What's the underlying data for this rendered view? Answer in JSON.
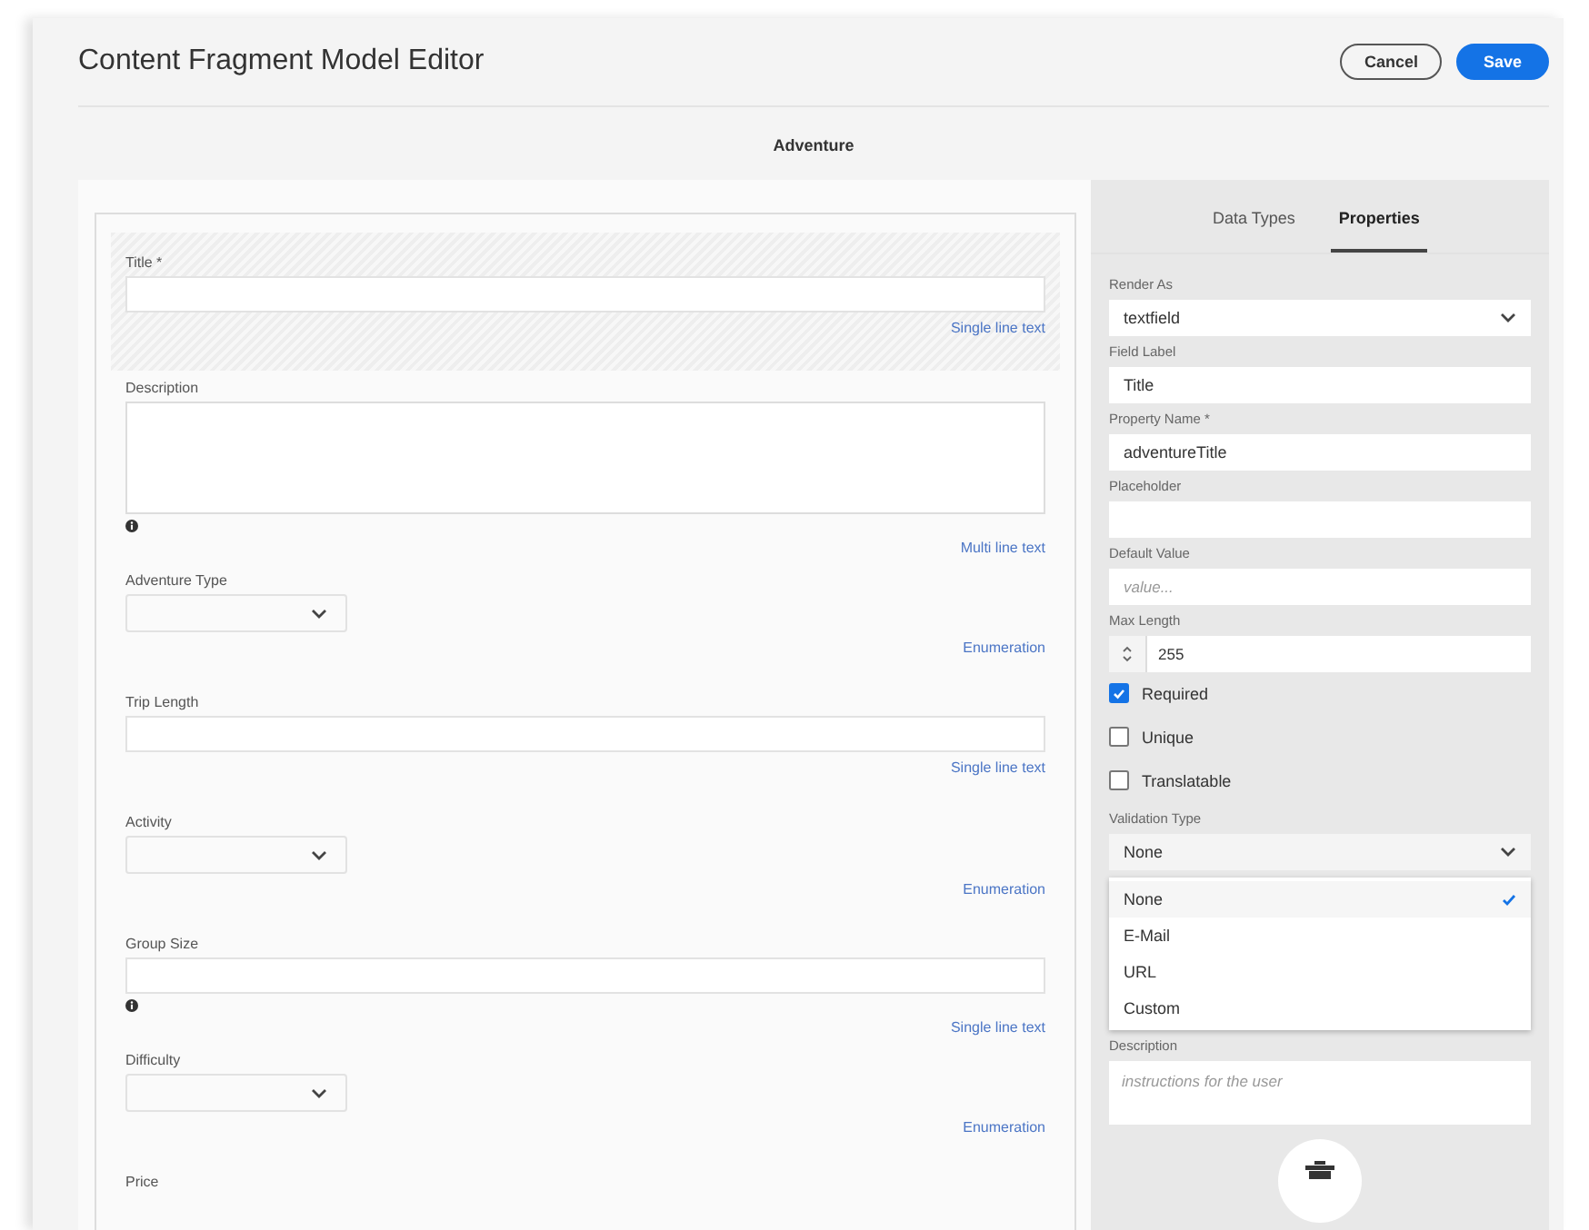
{
  "header": {
    "title": "Content Fragment Model Editor",
    "buttons": [
      {
        "label": "Cancel",
        "kind": "secondary"
      },
      {
        "label": "Save",
        "kind": "primary"
      }
    ]
  },
  "model_name": "Adventure",
  "fields": [
    {
      "label": "Title *",
      "kind": "text",
      "info": false,
      "type": "Single line text",
      "selected": true
    },
    {
      "label": "Description",
      "kind": "textarea",
      "info": true,
      "type": "Multi line text",
      "selected": false
    },
    {
      "label": "Adventure Type",
      "kind": "select",
      "info": false,
      "type": "Enumeration",
      "selected": false
    },
    {
      "label": "Trip Length",
      "kind": "text",
      "info": false,
      "type": "Single line text",
      "selected": false
    },
    {
      "label": "Activity",
      "kind": "select",
      "info": false,
      "type": "Enumeration",
      "selected": false
    },
    {
      "label": "Group Size",
      "kind": "text",
      "info": true,
      "type": "Single line text",
      "selected": false
    },
    {
      "label": "Difficulty",
      "kind": "select",
      "info": false,
      "type": "Enumeration",
      "selected": false
    },
    {
      "label": "Price",
      "kind": "label"
    }
  ],
  "tabs": [
    {
      "label": "Data Types",
      "selected": false
    },
    {
      "label": "Properties",
      "selected": true
    }
  ],
  "properties": [
    {
      "kind": "select",
      "label": "Render As",
      "value": "textfield"
    },
    {
      "kind": "input",
      "label": "Field Label",
      "value": "Title"
    },
    {
      "kind": "input",
      "label": "Property Name *",
      "value": "adventureTitle"
    },
    {
      "kind": "input",
      "label": "Placeholder"
    },
    {
      "kind": "input",
      "label": "Default Value",
      "placeholder": "value..."
    },
    {
      "kind": "number",
      "label": "Max Length",
      "value": "255"
    },
    {
      "kind": "checkbox",
      "label": "Required",
      "checked": true
    },
    {
      "kind": "checkbox",
      "label": "Unique",
      "checked": false
    },
    {
      "kind": "checkbox",
      "label": "Translatable",
      "checked": false
    },
    {
      "kind": "select",
      "label": "Validation Type",
      "value": "None",
      "options": [
        {
          "label": "None",
          "selected": true
        },
        {
          "label": "E-Mail",
          "selected": false
        },
        {
          "label": "URL",
          "selected": false
        },
        {
          "label": "Custom",
          "selected": false
        }
      ]
    },
    {
      "kind": "textarea",
      "label": "Description",
      "placeholder": "instructions for the user"
    },
    {
      "kind": "delete"
    }
  ]
}
